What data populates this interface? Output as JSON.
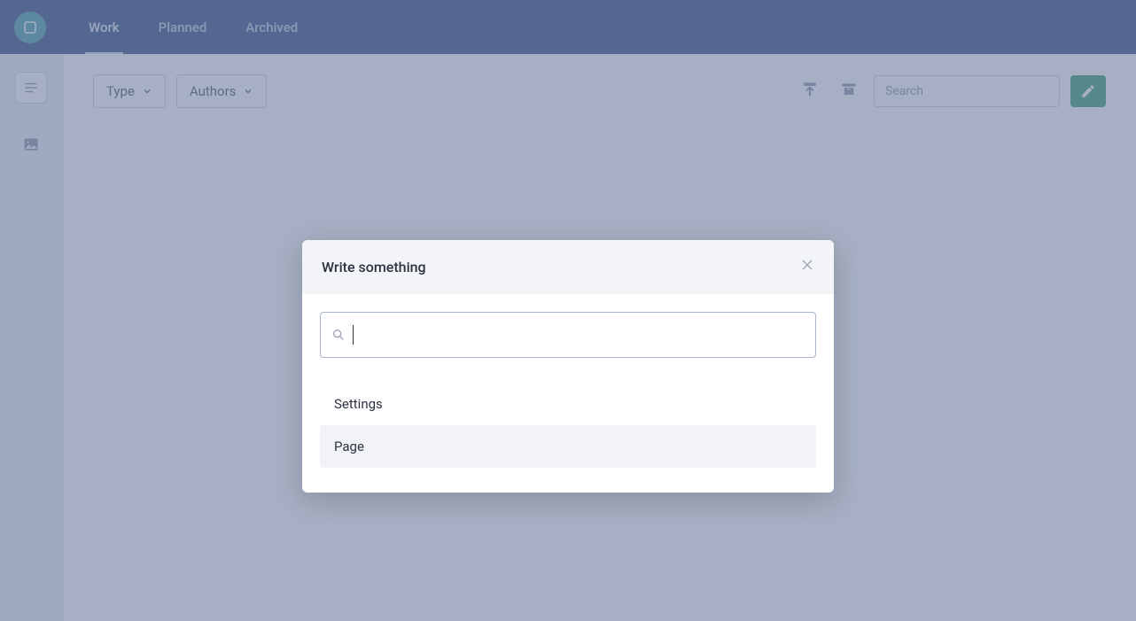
{
  "topbar": {
    "tabs": [
      {
        "label": "Work",
        "active": true
      },
      {
        "label": "Planned",
        "active": false
      },
      {
        "label": "Archived",
        "active": false
      }
    ]
  },
  "leftrail": {
    "items": [
      {
        "name": "text-lines-icon"
      },
      {
        "name": "image-icon"
      }
    ]
  },
  "toolbar": {
    "filters": {
      "type_label": "Type",
      "authors_label": "Authors"
    },
    "search_placeholder": "Search"
  },
  "modal": {
    "title": "Write something",
    "search_value": "",
    "options": [
      {
        "label": "Settings",
        "highlight": false
      },
      {
        "label": "Page",
        "highlight": true
      }
    ]
  }
}
